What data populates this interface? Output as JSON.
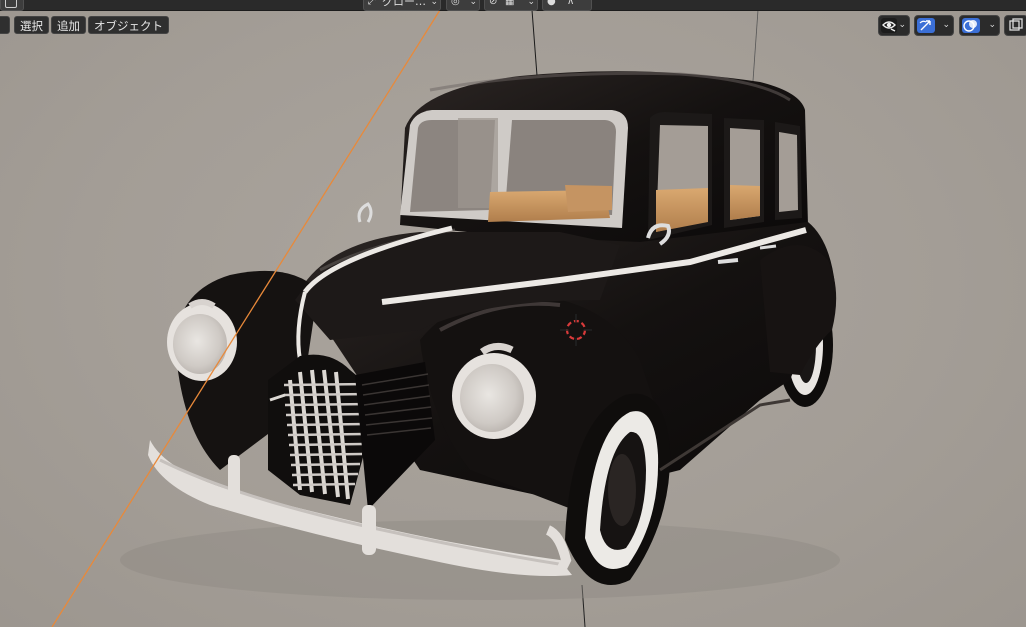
{
  "header": {
    "view_dropdown_label": "グロー…",
    "edit_menu": "",
    "menus": {
      "select": "選択",
      "add": "追加",
      "object": "オブジェクト"
    }
  },
  "overlays": {
    "visibility": "eye-icon",
    "gizmo": "gizmo-icon",
    "overlay": "overlay-icon",
    "accent": "#3b6fd6"
  },
  "scene": {
    "object": "1940s black sedan car model",
    "background": "#a59f98",
    "axis_line_color": "#e8893a"
  }
}
